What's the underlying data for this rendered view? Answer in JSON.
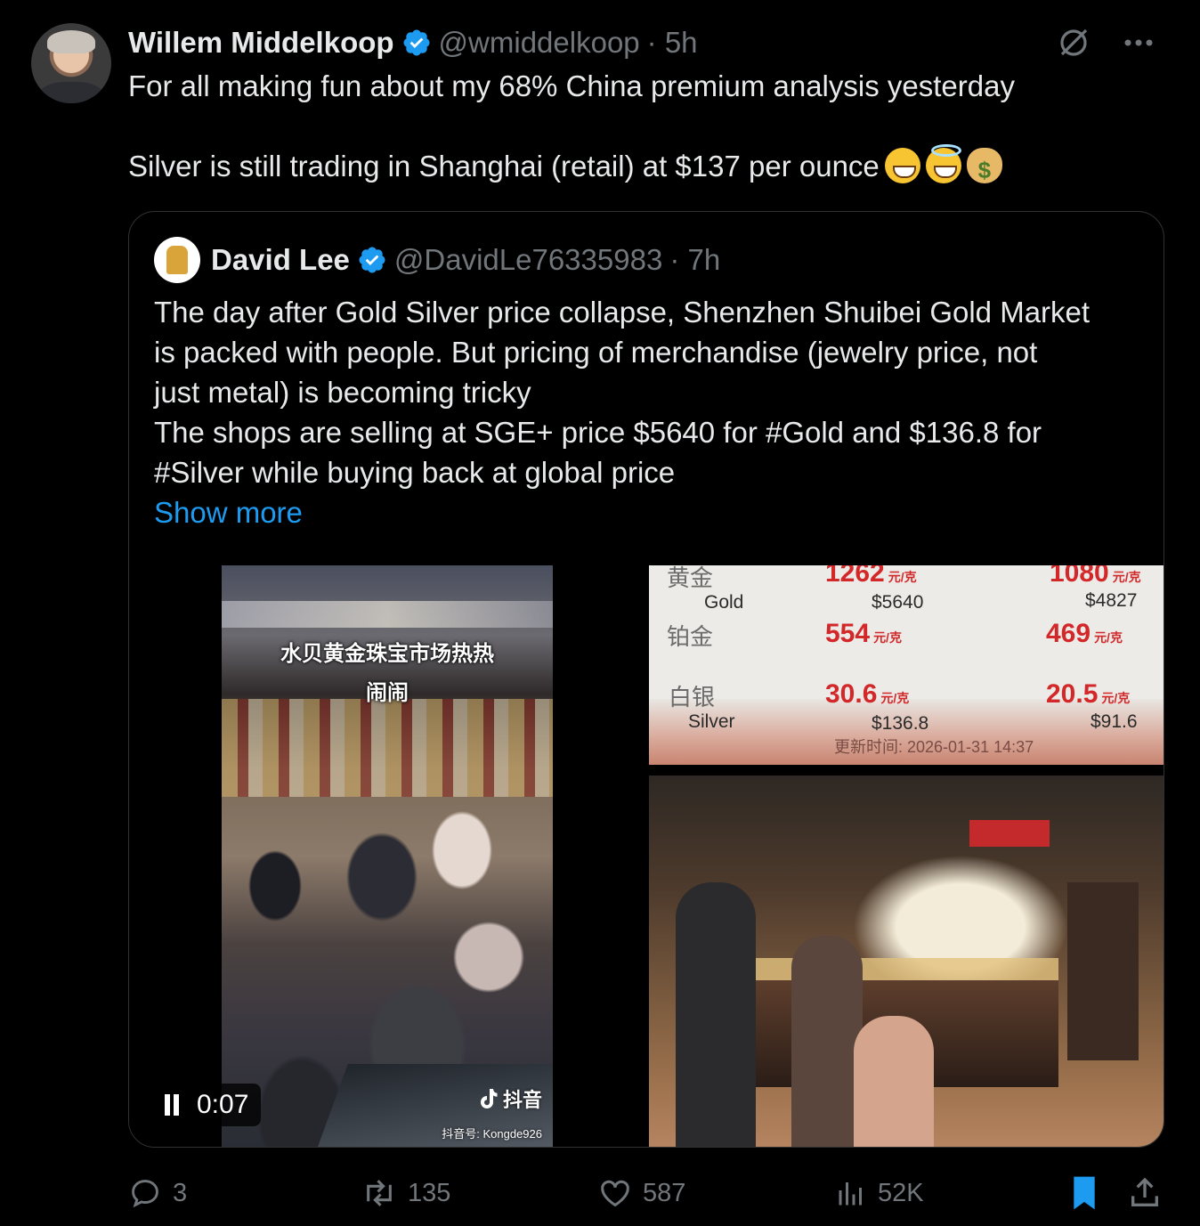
{
  "tweet": {
    "author_name": "Willem Middelkoop",
    "author_handle": "@wmiddelkoop",
    "time": "· 5h",
    "line1": "For all making fun about my 68% China premium analysis yesterday",
    "line2": "Silver is still trading in Shanghai (retail) at $137 per ounce",
    "emojis": [
      "grinning-face",
      "smiling-face-with-halo",
      "money-bag"
    ]
  },
  "quote": {
    "author_name": "David Lee",
    "author_handle": "@DavidLe76335983",
    "time": "· 7h",
    "lines": [
      "The day after Gold Silver price collapse, Shenzhen Shuibei Gold Market",
      "is packed with people. But pricing of merchandise (jewelry price, not",
      "just metal) is becoming tricky",
      "The shops are selling at SGE+ price $5640 for #Gold and $136.8 for",
      "#Silver while buying back at global price"
    ],
    "show_more": "Show more"
  },
  "video": {
    "caption_line1": "水贝黄金珠宝市场热热",
    "caption_line2": "闹闹",
    "elapsed": "0:07",
    "tiktok_label": "抖音",
    "tiktok_id": "抖音号: Kongde926"
  },
  "price_board": {
    "gold_cn": "黄金",
    "gold_en": "Gold",
    "gold_sell": "1262",
    "gold_sell_usd": "$5640",
    "gold_buy": "1080",
    "gold_buy_usd": "$4827",
    "platinum_cn": "铂金",
    "platinum_sell": "554",
    "platinum_buy": "469",
    "silver_cn": "白银",
    "silver_en": "Silver",
    "silver_sell": "30.6",
    "silver_sell_usd": "$136.8",
    "silver_buy": "20.5",
    "silver_buy_usd": "$91.6",
    "unit": "元/克",
    "updated": "更新时间: 2026-01-31 14:37"
  },
  "actions": {
    "replies": "3",
    "reposts": "135",
    "likes": "587",
    "views": "52K"
  },
  "colors": {
    "background": "#000000",
    "text": "#e7e9ea",
    "muted": "#71767b",
    "accent": "#1d9bf0",
    "verified": "#1d9bf0",
    "price_red": "#d2282a"
  }
}
